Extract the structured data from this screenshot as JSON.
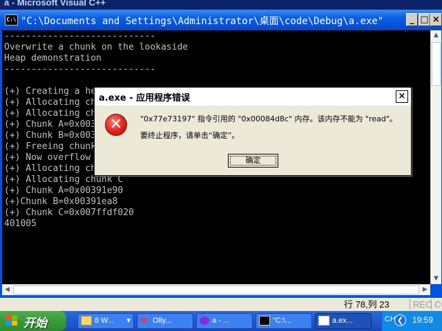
{
  "background_app": {
    "title": "a - Microsoft Visual C++"
  },
  "console": {
    "icon_label": "C:\\",
    "title": "\"C:\\Documents and Settings\\Administrator\\桌面\\code\\Debug\\a.exe\"",
    "buttons": {
      "minimize": "_",
      "maximize": "□",
      "close": "×"
    },
    "lines": [
      "----------------------------",
      "Overwrite a chunk on the lookaside",
      "Heap demonstration",
      "----------------------------",
      "",
      "(+) Creating a heap",
      "(+) Allocating chunk A",
      "(+) Allocating chunk B",
      "(+) Chunk A=0x00391e90",
      "(+) Chunk B=0x00391ea8",
      "(+) Freeing chunk B",
      "(+) Now overflow chunk A",
      "(+) Allocating chunk B",
      "(+) Allocating chunk C",
      "(+) Chunk A=0x00391e90",
      "(+)Chunk B=0x00391ea8",
      "(+) Chunk C=0x007ffdf020",
      "401005"
    ]
  },
  "status_bar": {
    "position": "行 78,列 23",
    "rec": "REC",
    "col": "CO"
  },
  "dialog": {
    "title": "a.exe - 应用程序错误",
    "close": "×",
    "message_line1": "\"0x77e73197\" 指令引用的 \"0x00084d8c\" 内存。该内存不能为 \"read\"。",
    "message_line2": "要终止程序，请单击“确定”。",
    "ok_label": "确定"
  },
  "taskbar": {
    "start_label": "开始",
    "tasks": [
      {
        "label": "8 W..."
      },
      {
        "label": "Olly..."
      },
      {
        "label": "a - ..."
      },
      {
        "label": "\"C:\\..."
      },
      {
        "label": "a.ex..."
      }
    ],
    "tray": {
      "lang": "CH",
      "time": "19:59"
    }
  },
  "colors": {
    "console_bg": "#000000",
    "console_text": "#c0c0c0",
    "titlebar_blue": "#0a5fe0",
    "taskbar_blue": "#245edb",
    "start_green": "#3a9a3a",
    "error_red": "#e0221a"
  }
}
